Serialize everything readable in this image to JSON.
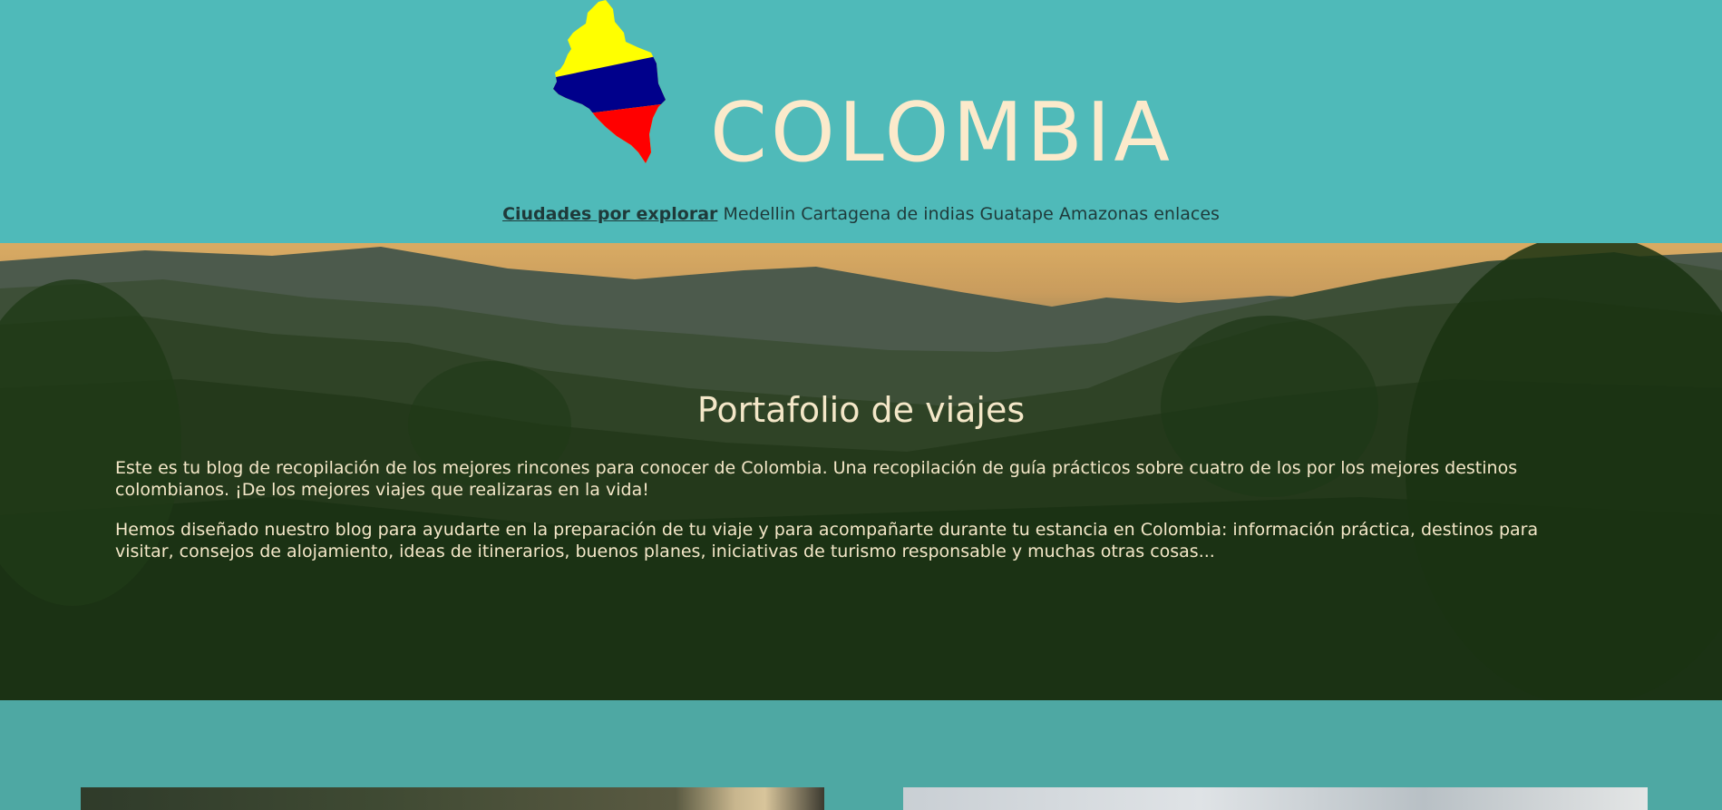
{
  "header": {
    "logo_icon": "colombia-map-flag-icon",
    "title": "COLOMBIA",
    "flag_colors": {
      "yellow": "#ffff00",
      "blue": "#00008b",
      "red": "#ff0000"
    }
  },
  "nav": {
    "heading": "Ciudades por explorar",
    "items": [
      {
        "label": "Medellin"
      },
      {
        "label": "Cartagena de indias"
      },
      {
        "label": "Guatape"
      },
      {
        "label": "Amazonas"
      },
      {
        "label": "enlaces"
      }
    ]
  },
  "hero": {
    "title": "Portafolio de viajes",
    "paragraphs": [
      "Este es tu blog de recopilación de los mejores rincones para conocer de Colombia. Una recopilación de guía prácticos sobre cuatro de los por los mejores destinos colombianos. ¡De los mejores viajes que realizaras en la vida!",
      "Hemos diseñado nuestro blog para ayudarte en la preparación de tu viaje y para acompañarte durante tu estancia en Colombia: información práctica, destinos para visitar, consejos de alojamiento, ideas de itinerarios, buenos planes, iniciativas de turismo responsable y muchas otras cosas..."
    ]
  },
  "colors": {
    "header_bg": "#4fbab9",
    "title_text": "#fbeacb",
    "section_bg": "#4ea8a3"
  }
}
